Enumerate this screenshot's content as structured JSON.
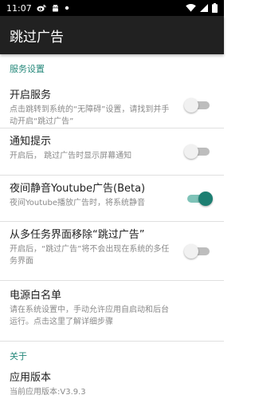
{
  "status_bar": {
    "time": "11:07"
  },
  "app_bar": {
    "title": "跳过广告"
  },
  "sections": {
    "service": {
      "header": "服务设置"
    },
    "about": {
      "header": "关于"
    }
  },
  "prefs": {
    "enable_service": {
      "title": "开启服务",
      "summary": "点击跳转到系统的“无障碍”设置，请找到并手动开启“跳过广告”",
      "checked": false
    },
    "notification": {
      "title": "通知提示",
      "summary": "开启后， 跳过广告时显示屏幕通知",
      "checked": false
    },
    "night_mute": {
      "title": "夜间静音Youtube广告(Beta)",
      "summary": "夜间Youtube播放广告时，将系统静音",
      "checked": true
    },
    "hide_recents": {
      "title": "从多任务界面移除“跳过广告”",
      "summary": "开启后，“跳过广告”将不会出现在系统的多任务界面",
      "checked": false
    },
    "whitelist": {
      "title": "电源白名单",
      "summary": "请在系统设置中，手动允许应用自启动和后台运行。点击这里了解详细步骤"
    },
    "version": {
      "title": "应用版本",
      "summary": "当前应用版本:V3.9.3"
    }
  },
  "colors": {
    "accent": "#26897b",
    "app_bar": "#212121",
    "status_bar": "#000000"
  },
  "icons": {
    "status_left": [
      "weibo-icon",
      "android-debug-icon",
      "notification-dot-icon"
    ],
    "status_right": [
      "wifi-icon",
      "cellular-signal-icon",
      "battery-icon"
    ]
  }
}
